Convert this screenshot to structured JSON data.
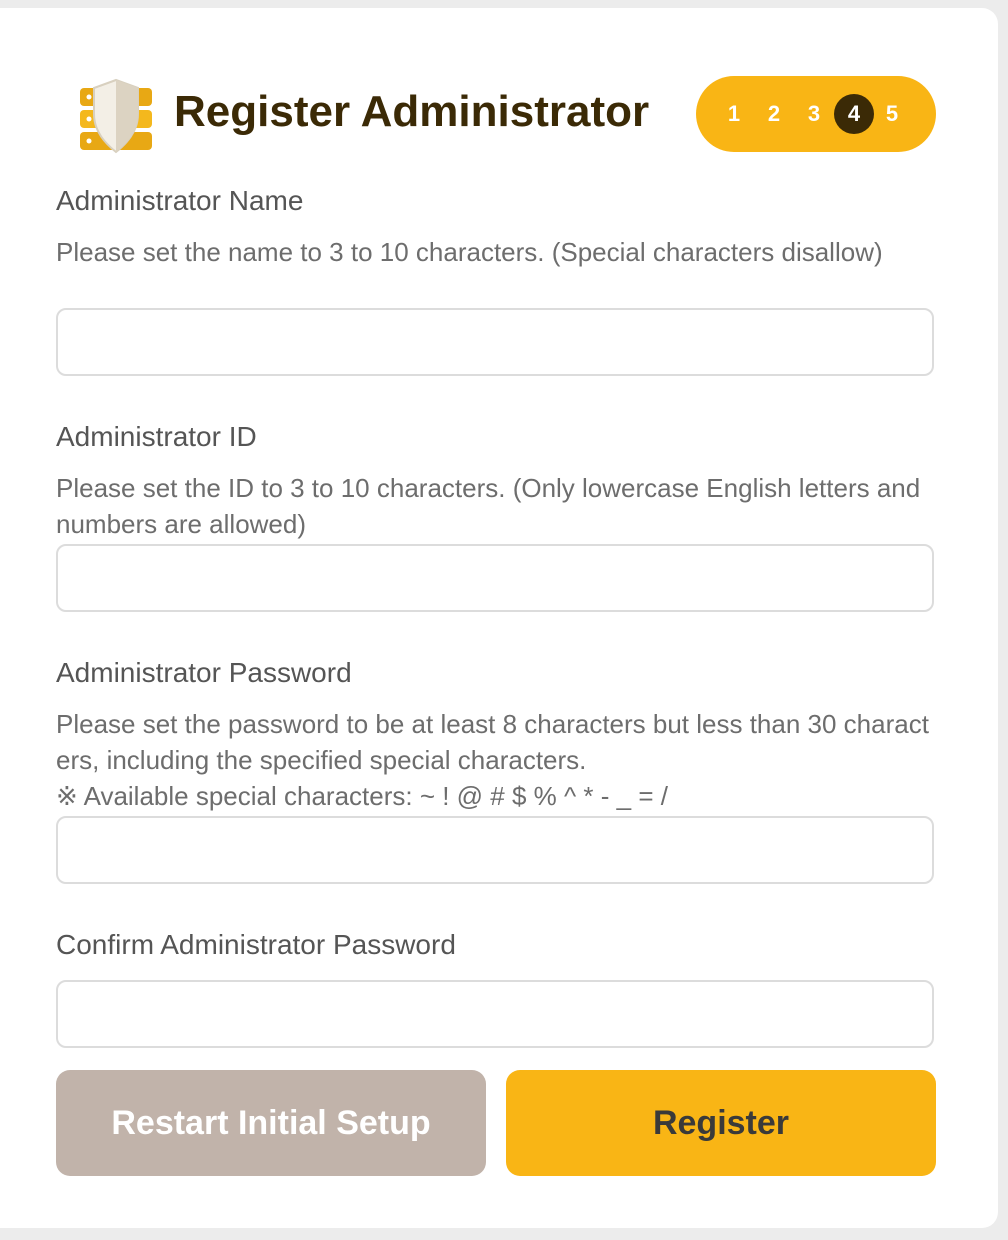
{
  "header": {
    "title": "Register Administrator",
    "logo_icon": "server-shield-icon",
    "steps": [
      "1",
      "2",
      "3",
      "4",
      "5"
    ],
    "active_step": "4"
  },
  "form": {
    "name": {
      "label": "Administrator Name",
      "help": "Please set the name to 3 to 10 characters. (Special characters disallow)",
      "value": "",
      "placeholder": ""
    },
    "id": {
      "label": "Administrator ID",
      "help": "Please set the ID to 3 to 10 characters. (Only lowercase English letters and numbers are allowed)",
      "value": "",
      "placeholder": ""
    },
    "password": {
      "label": "Administrator Password",
      "help_line1": "Please set the password to be at least 8 characters but less than 30 characters, including the specified special characters.",
      "help_line2": "※ Available special characters: ~ ! @ # $ % ^ * - _ = /",
      "value": "",
      "placeholder": ""
    },
    "confirm_password": {
      "label": "Confirm Administrator Password",
      "value": "",
      "placeholder": ""
    }
  },
  "buttons": {
    "restart_label": "Restart Initial Setup",
    "register_label": "Register"
  },
  "colors": {
    "accent": "#f9b515",
    "title": "#3b2a06",
    "restart_button": "#c1b3aa"
  }
}
